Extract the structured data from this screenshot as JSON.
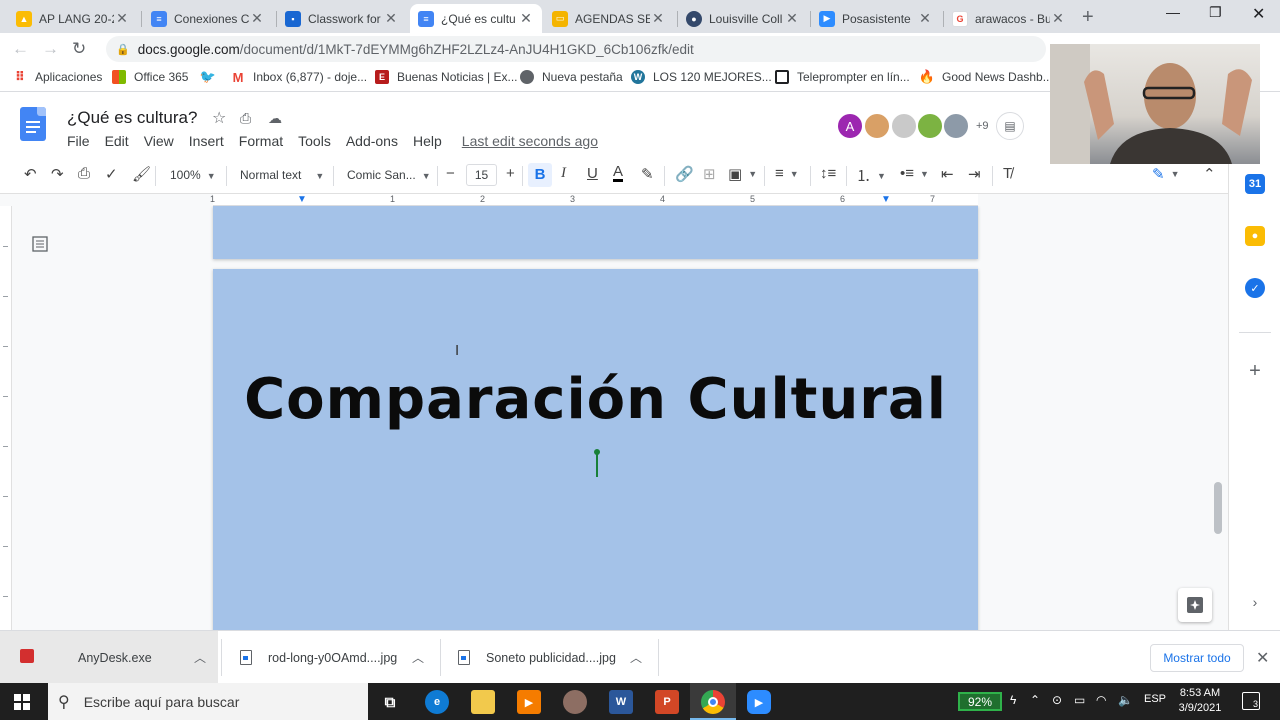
{
  "browser": {
    "tabs": [
      {
        "label": "AP LANG 20-2",
        "favicon": "drive-icon",
        "color": "#fbbc04"
      },
      {
        "label": "Conexiones C",
        "favicon": "docs-icon",
        "color": "#4285f4"
      },
      {
        "label": "Classwork for",
        "favicon": "classroom-icon",
        "color": "#1967d2"
      },
      {
        "label": "¿Qué es cultu",
        "favicon": "docs-icon",
        "color": "#4285f4",
        "active": true
      },
      {
        "label": "AGENDAS SEG",
        "favicon": "slides-icon",
        "color": "#f4b400"
      },
      {
        "label": "Louisville Coll",
        "favicon": "globe-icon",
        "color": "#34496b"
      },
      {
        "label": "Posasistente",
        "favicon": "zoom-icon",
        "color": "#2d8cff"
      },
      {
        "label": "arawacos - Bu",
        "favicon": "google-icon",
        "color": "#ea4335"
      }
    ],
    "new_tab": "+",
    "url_host": "docs.google.com",
    "url_path": "/document/d/1MkT-7dEYMMg6hZHF2LZLz4-AnJU4H1GKD_6Cb106zfk/edit"
  },
  "bookmarks": [
    {
      "label": "Aplicaciones",
      "icon": "apps-grid-icon",
      "color": "#ea4335"
    },
    {
      "label": "Office 365",
      "icon": "office-icon",
      "color": "#f25022"
    },
    {
      "label": "",
      "icon": "twitter-icon",
      "color": "#1da1f2"
    },
    {
      "label": "Inbox (6,877) - doje...",
      "icon": "gmail-icon",
      "color": "#ea4335"
    },
    {
      "label": "Buenas Noticias | Ex...",
      "icon": "news-icon",
      "color": "#b71c1c"
    },
    {
      "label": "Nueva pestaña",
      "icon": "globe-icon",
      "color": "#5f6368"
    },
    {
      "label": "LOS 120 MEJORES...",
      "icon": "wordpress-icon",
      "color": "#21759b"
    },
    {
      "label": "Teleprompter en lín...",
      "icon": "tv-icon",
      "color": "#202124"
    },
    {
      "label": "Good News Dashb...",
      "icon": "fire-icon",
      "color": "#ff6d00"
    }
  ],
  "docs": {
    "title": "¿Qué es cultura?",
    "menu": [
      "File",
      "Edit",
      "View",
      "Insert",
      "Format",
      "Tools",
      "Add-ons",
      "Help"
    ],
    "last_edit": "Last edit seconds ago",
    "collaborators_more": "+9",
    "first_avatar_letter": "A"
  },
  "toolbar": {
    "zoom": "100%",
    "style": "Normal text",
    "font": "Comic San...",
    "font_size": "15",
    "bold_label": "B",
    "italic_label": "I",
    "underline_label": "U",
    "text_color_label": "A"
  },
  "ruler": {
    "numbers": [
      "1",
      "1",
      "2",
      "3",
      "4",
      "5",
      "6",
      "7"
    ]
  },
  "document": {
    "heading": "Comparación Cultural",
    "page_color": "#a4c2e8"
  },
  "downloads": [
    {
      "name": "AnyDesk.exe",
      "icon": "anydesk-icon"
    },
    {
      "name": "rod-long-y0OAmd....jpg",
      "icon": "file-icon"
    },
    {
      "name": "Soneto publicidad....jpg",
      "icon": "file-icon"
    }
  ],
  "downloads_show_all": "Mostrar todo",
  "taskbar": {
    "search_placeholder": "Escribe aquí para buscar",
    "battery": "92%",
    "language": "ESP",
    "time": "8:53 AM",
    "date": "3/9/2021",
    "notifications": "3"
  }
}
